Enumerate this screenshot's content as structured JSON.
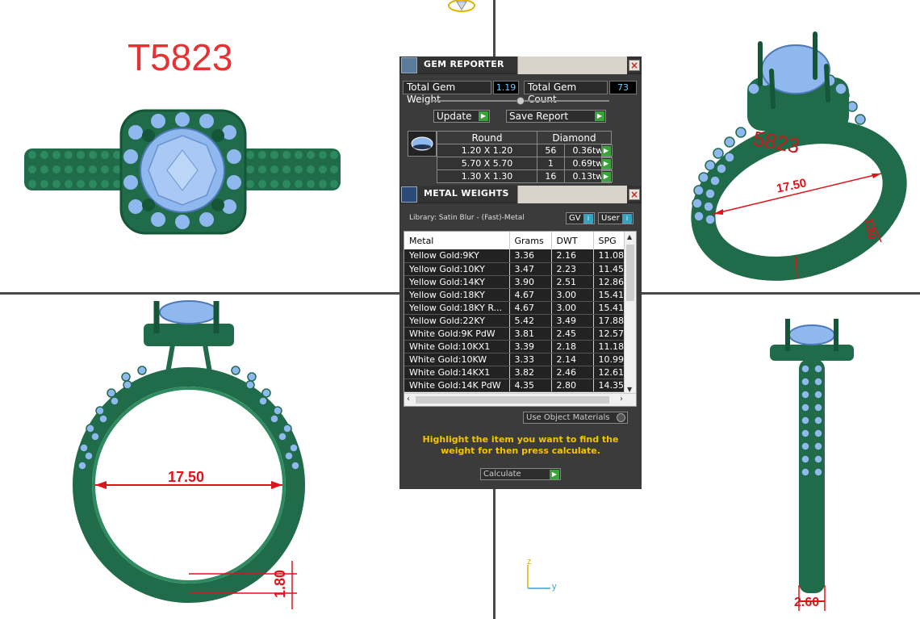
{
  "model_code": "T5823",
  "dimensions": {
    "front_diameter": "17.50",
    "front_height": "1.80",
    "iso_diameter": "17.50",
    "iso_height": "1.80",
    "side_width": "2.60"
  },
  "axis": {
    "z": "z",
    "y": "y"
  },
  "gem_reporter": {
    "title": "GEM REPORTER",
    "total_weight_label": "Total Gem Weight",
    "total_weight_value": "1.19",
    "total_count_label": "Total Gem Count",
    "total_count_value": "73",
    "update_label": "Update",
    "save_label": "Save Report",
    "shape": "Round",
    "type": "Diamond",
    "rows": [
      {
        "size": "1.20 X 1.20",
        "count": "56",
        "weight": "0.36tw"
      },
      {
        "size": "5.70 X 5.70",
        "count": "1",
        "weight": "0.69tw"
      },
      {
        "size": "1.30 X 1.30",
        "count": "16",
        "weight": "0.13tw"
      }
    ]
  },
  "metal_weights": {
    "title": "METAL WEIGHTS",
    "library": "Library: Satin Blur - (Fast)-Metal",
    "gv_label": "GV",
    "user_label": "User",
    "columns": [
      "Metal",
      "Grams",
      "DWT",
      "SPG"
    ],
    "rows": [
      {
        "metal": "Yellow Gold:9KY",
        "grams": "3.36",
        "dwt": "2.16",
        "spg": "11.08"
      },
      {
        "metal": "Yellow Gold:10KY",
        "grams": "3.47",
        "dwt": "2.23",
        "spg": "11.45"
      },
      {
        "metal": "Yellow Gold:14KY",
        "grams": "3.90",
        "dwt": "2.51",
        "spg": "12.86"
      },
      {
        "metal": "Yellow Gold:18KY",
        "grams": "4.67",
        "dwt": "3.00",
        "spg": "15.41"
      },
      {
        "metal": "Yellow Gold:18KY R...",
        "grams": "4.67",
        "dwt": "3.00",
        "spg": "15.41"
      },
      {
        "metal": "Yellow Gold:22KY",
        "grams": "5.42",
        "dwt": "3.49",
        "spg": "17.88"
      },
      {
        "metal": "White Gold:9K PdW",
        "grams": "3.81",
        "dwt": "2.45",
        "spg": "12.57"
      },
      {
        "metal": "White Gold:10KX1",
        "grams": "3.39",
        "dwt": "2.18",
        "spg": "11.18"
      },
      {
        "metal": "White Gold:10KW",
        "grams": "3.33",
        "dwt": "2.14",
        "spg": "10.99"
      },
      {
        "metal": "White Gold:14KX1",
        "grams": "3.82",
        "dwt": "2.46",
        "spg": "12.61"
      },
      {
        "metal": "White Gold:14K PdW",
        "grams": "4.35",
        "dwt": "2.80",
        "spg": "14.35"
      }
    ],
    "use_object_materials": "Use Object Materials",
    "hint": "Highlight the item you want to find the weight for then press calculate.",
    "calculate_label": "Calculate"
  },
  "colors": {
    "metal": "#1f6b4a",
    "gem": "#8fb8ee",
    "dimension": "#e0121a",
    "panel": "#3b3b3b"
  }
}
